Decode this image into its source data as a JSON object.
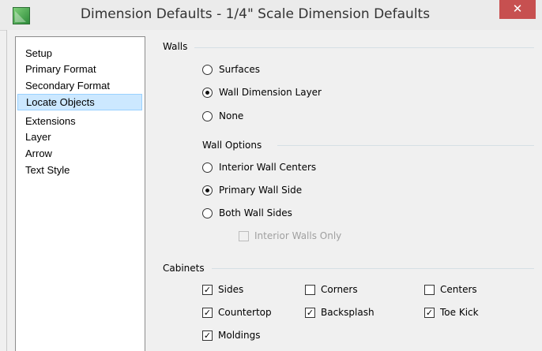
{
  "window": {
    "title": "Dimension Defaults - 1/4\" Scale Dimension Defaults",
    "close_glyph": "✕"
  },
  "sidebar": {
    "items": [
      {
        "label": "Setup"
      },
      {
        "label": "Primary Format"
      },
      {
        "label": "Secondary Format"
      },
      {
        "label": "Locate Objects",
        "selected": true
      },
      {
        "label": "Extensions"
      },
      {
        "label": "Layer"
      },
      {
        "label": "Arrow"
      },
      {
        "label": "Text Style"
      }
    ]
  },
  "walls": {
    "label": "Walls",
    "options": [
      {
        "label": "Surfaces",
        "selected": false
      },
      {
        "label": "Wall Dimension Layer",
        "selected": true
      },
      {
        "label": "None",
        "selected": false
      }
    ]
  },
  "wall_options": {
    "label": "Wall Options",
    "options": [
      {
        "label": "Interior Wall Centers",
        "selected": false
      },
      {
        "label": "Primary Wall Side",
        "selected": true
      },
      {
        "label": "Both Wall Sides",
        "selected": false
      }
    ],
    "interior_only": {
      "label": "Interior Walls Only",
      "checked": false,
      "disabled": true
    }
  },
  "cabinets": {
    "label": "Cabinets",
    "checkboxes": [
      {
        "label": "Sides",
        "checked": true
      },
      {
        "label": "Corners",
        "checked": false
      },
      {
        "label": "Centers",
        "checked": false
      },
      {
        "label": "Countertop",
        "checked": true
      },
      {
        "label": "Backsplash",
        "checked": true
      },
      {
        "label": "Toe Kick",
        "checked": true
      },
      {
        "label": "Moldings",
        "checked": true
      }
    ],
    "check_glyph": "✓"
  },
  "colors": {
    "selection_bg": "#cce8ff",
    "close_bg": "#c75050"
  }
}
